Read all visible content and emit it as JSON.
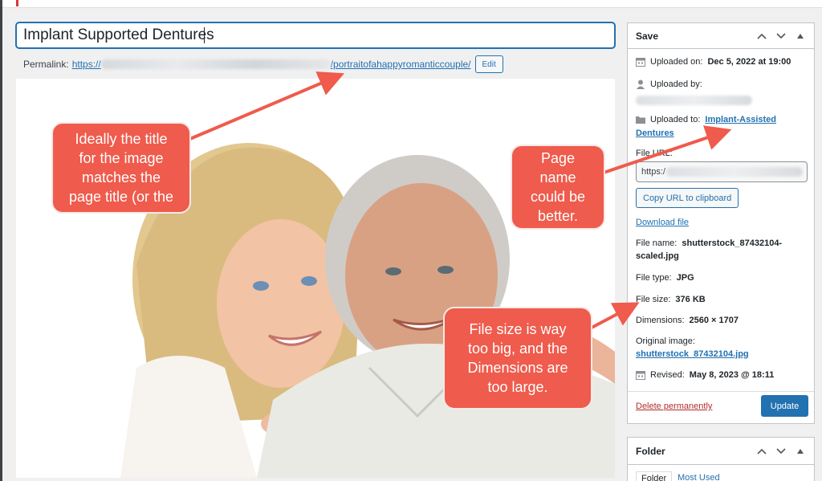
{
  "editor": {
    "title_value": "Implant Supported Dentures",
    "permalink_label": "Permalink:",
    "permalink_prefix": "https://",
    "permalink_slug": "/portraitofahappyromanticcouple/",
    "edit_label": "Edit"
  },
  "save_box": {
    "title": "Save",
    "uploaded_on_label": "Uploaded on:",
    "uploaded_on_value": "Dec 5, 2022 at 19:00",
    "uploaded_by_label": "Uploaded by:",
    "uploaded_to_label": "Uploaded to:",
    "uploaded_to_value_1": "Implant-Assisted",
    "uploaded_to_value_2": "Dentures",
    "file_url_label": "File URL:",
    "file_url_value": "https:/",
    "copy_label": "Copy URL to clipboard",
    "download_label": "Download file",
    "file_name_label": "File name:",
    "file_name_value_1": "shutterstock_87432104-",
    "file_name_value_2": "scaled.jpg",
    "file_type_label": "File type:",
    "file_type_value": "JPG",
    "file_size_label": "File size:",
    "file_size_value": "376 KB",
    "dimensions_label": "Dimensions:",
    "dimensions_value": "2560 × 1707",
    "original_label": "Original image:",
    "original_value": "shutterstock_87432104.jpg",
    "revised_label": "Revised:",
    "revised_value": "May 8, 2023 @ 18:11",
    "delete_label": "Delete permanently",
    "update_label": "Update"
  },
  "folder_box": {
    "title": "Folder",
    "tab_folder": "Folder",
    "tab_most_used": "Most Used"
  },
  "annotations": {
    "title_note_lines": [
      "Ideally the title",
      "for the image",
      "matches the",
      "page title (or the"
    ],
    "page_name_lines": [
      "Page",
      "name",
      "could be",
      "better."
    ],
    "file_size_lines": [
      "File size is way",
      "too big, and the",
      "Dimensions are",
      "too large."
    ]
  },
  "colors": {
    "accent": "#2271b1",
    "callout": "#ef5b4c",
    "delete": "#b32d2e"
  }
}
